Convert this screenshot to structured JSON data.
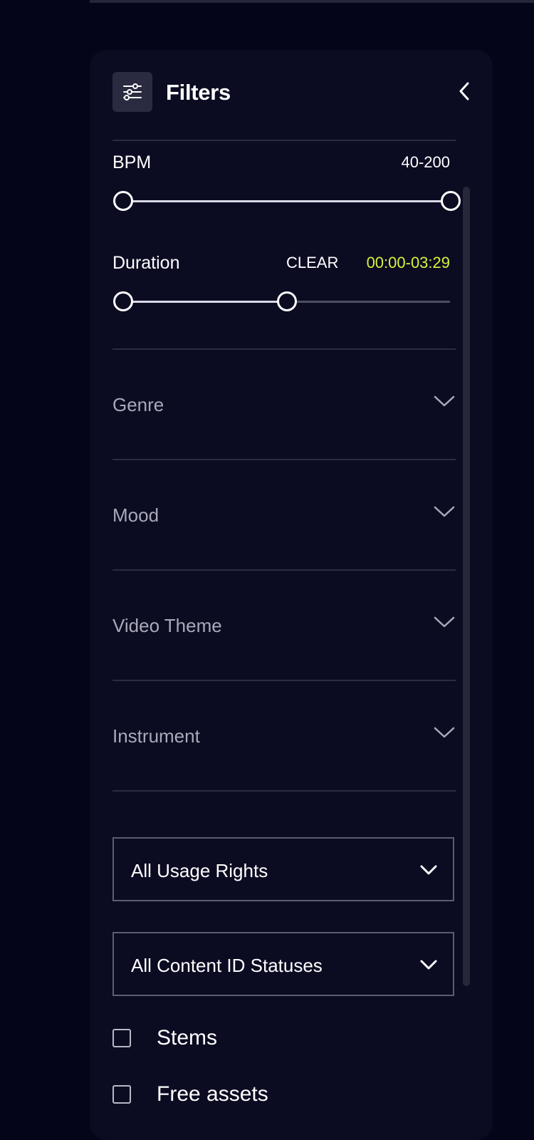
{
  "panel": {
    "title": "Filters",
    "icon": "sliders-icon",
    "collapse_icon": "chevron-left-icon"
  },
  "bpm": {
    "label": "BPM",
    "value": "40-200",
    "range_fraction": [
      0.0,
      1.0
    ]
  },
  "duration": {
    "label": "Duration",
    "clear_label": "CLEAR",
    "value": "00:00-03:29",
    "range_fraction": [
      0.0,
      0.5
    ]
  },
  "accordions": [
    {
      "label": "Genre"
    },
    {
      "label": "Mood"
    },
    {
      "label": "Video Theme"
    },
    {
      "label": "Instrument"
    }
  ],
  "selects": [
    {
      "label": "All Usage Rights"
    },
    {
      "label": "All Content ID Statuses"
    }
  ],
  "checkboxes": [
    {
      "label": "Stems",
      "checked": false
    },
    {
      "label": "Free assets",
      "checked": false
    }
  ],
  "colors": {
    "background": "#05051a",
    "panel": "#0b0c22",
    "accent_yellow": "#d8f43a"
  }
}
